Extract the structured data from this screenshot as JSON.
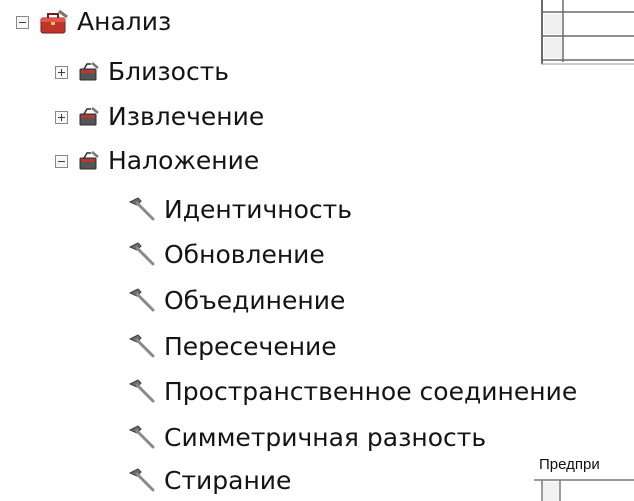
{
  "tree": {
    "root": {
      "label": "Анализ",
      "expander": "minus",
      "icon": "toolbox-icon"
    },
    "toolsets": [
      {
        "label": "Близость",
        "expander": "plus",
        "icon": "toolset-icon"
      },
      {
        "label": "Извлечение",
        "expander": "plus",
        "icon": "toolset-icon"
      },
      {
        "label": "Наложение",
        "expander": "minus",
        "icon": "toolset-icon"
      }
    ],
    "tools": [
      {
        "label": "Идентичность",
        "icon": "hammer-icon"
      },
      {
        "label": "Обновление",
        "icon": "hammer-icon"
      },
      {
        "label": "Объединение",
        "icon": "hammer-icon"
      },
      {
        "label": "Пересечение",
        "icon": "hammer-icon"
      },
      {
        "label": "Пространственное соединение",
        "icon": "hammer-icon"
      },
      {
        "label": "Симметричная разность",
        "icon": "hammer-icon"
      },
      {
        "label": "Стирание",
        "icon": "hammer-icon"
      }
    ]
  },
  "background_panel": {
    "caption": "Предпри"
  },
  "colors": {
    "toolbox_red": "#c0352b",
    "toolset_dark": "#4a4a4a",
    "hammer_gray": "#6d6d6d",
    "expander_border": "#8a8a8a"
  }
}
